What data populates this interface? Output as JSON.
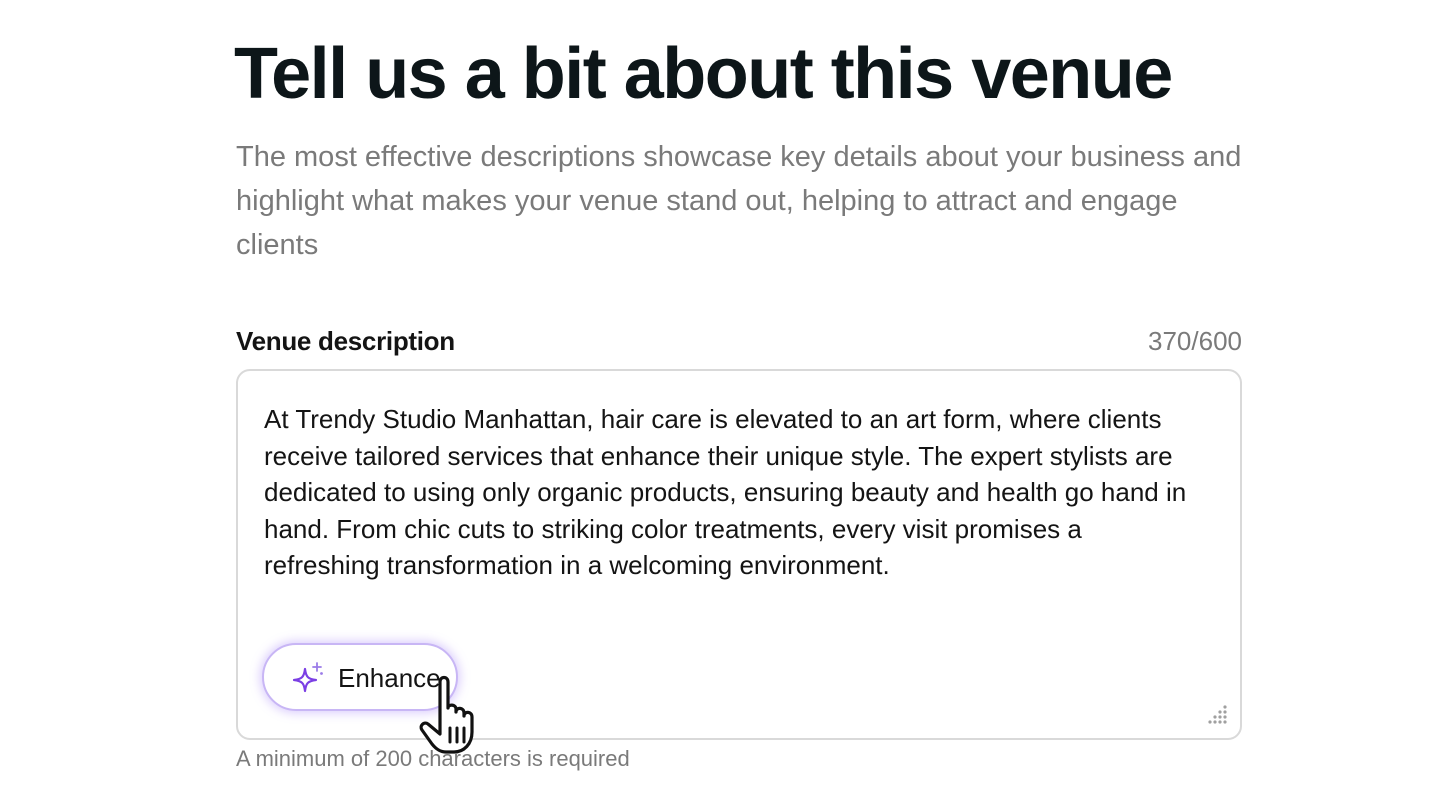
{
  "header": {
    "title": "Tell us a bit about this venue",
    "subtitle": "The most effective descriptions showcase key details about your business and highlight what makes your venue stand out, helping to attract and engage clients"
  },
  "venue_description": {
    "label": "Venue description",
    "counter": "370/600",
    "value": "At Trendy Studio Manhattan, hair care is elevated to an art form, where clients receive tailored services that enhance their unique style. The expert stylists are dedicated to using only organic products, ensuring beauty and health go hand in hand. From chic cuts to striking color treatments, every visit promises a refreshing transformation in a welcoming environment.",
    "enhance_button_label": "Enhance",
    "enhance_icon": "sparkle-icon",
    "helper_text": "A minimum of 200 characters is required"
  },
  "colors": {
    "title": "#0d1619",
    "muted": "#7a7a7a",
    "accent_purple": "#7b3fe4",
    "border": "#d9d9d9"
  }
}
